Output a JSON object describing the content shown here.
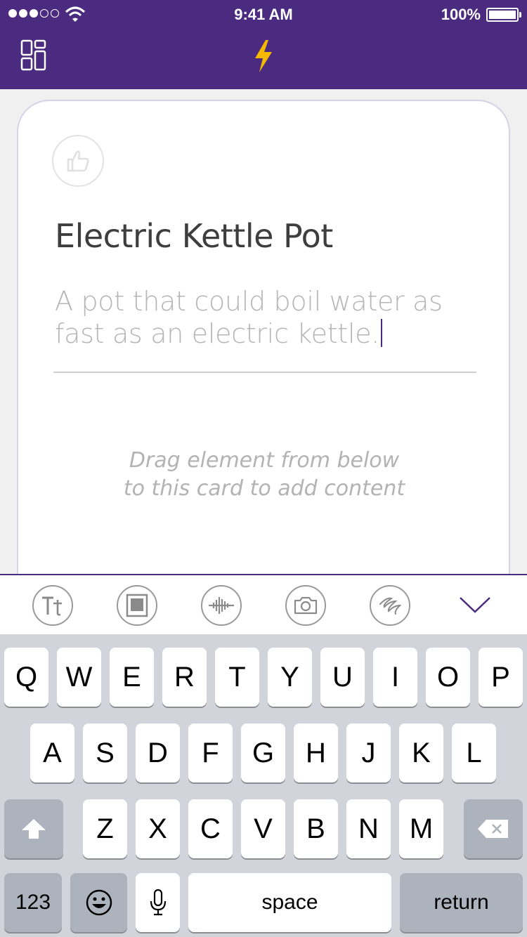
{
  "status_bar": {
    "time": "9:41 AM",
    "battery": "100%",
    "signal_bars": 3,
    "signal_total": 5
  },
  "nav": {
    "layout_icon": "layout-grid-icon",
    "center_icon": "lightning-bolt-icon",
    "accent": "#f5b800",
    "bar_color": "#4a2b80"
  },
  "card": {
    "like_icon": "thumbs-up-icon",
    "title": "Electric Kettle Pot",
    "description": "A pot that could boil water as fast as an electric kettle.",
    "hint": "Drag element from below\nto this card to add content"
  },
  "toolbar": {
    "tools": [
      {
        "name": "text-tool",
        "icon": "text-format-icon"
      },
      {
        "name": "image-tool",
        "icon": "image-frame-icon"
      },
      {
        "name": "audio-tool",
        "icon": "audio-wave-icon"
      },
      {
        "name": "camera-tool",
        "icon": "camera-icon"
      },
      {
        "name": "drawing-tool",
        "icon": "scribble-icon"
      }
    ],
    "collapse_icon": "chevron-down-icon"
  },
  "keyboard": {
    "row1": [
      "Q",
      "W",
      "E",
      "R",
      "T",
      "Y",
      "U",
      "I",
      "O",
      "P"
    ],
    "row2": [
      "A",
      "S",
      "D",
      "F",
      "G",
      "H",
      "J",
      "K",
      "L"
    ],
    "row3": [
      "Z",
      "X",
      "C",
      "V",
      "B",
      "N",
      "M"
    ],
    "numbers_label": "123",
    "space_label": "space",
    "return_label": "return",
    "shift_icon": "shift-arrow-icon",
    "delete_icon": "backspace-icon",
    "emoji_icon": "emoji-icon",
    "mic_icon": "microphone-icon"
  }
}
